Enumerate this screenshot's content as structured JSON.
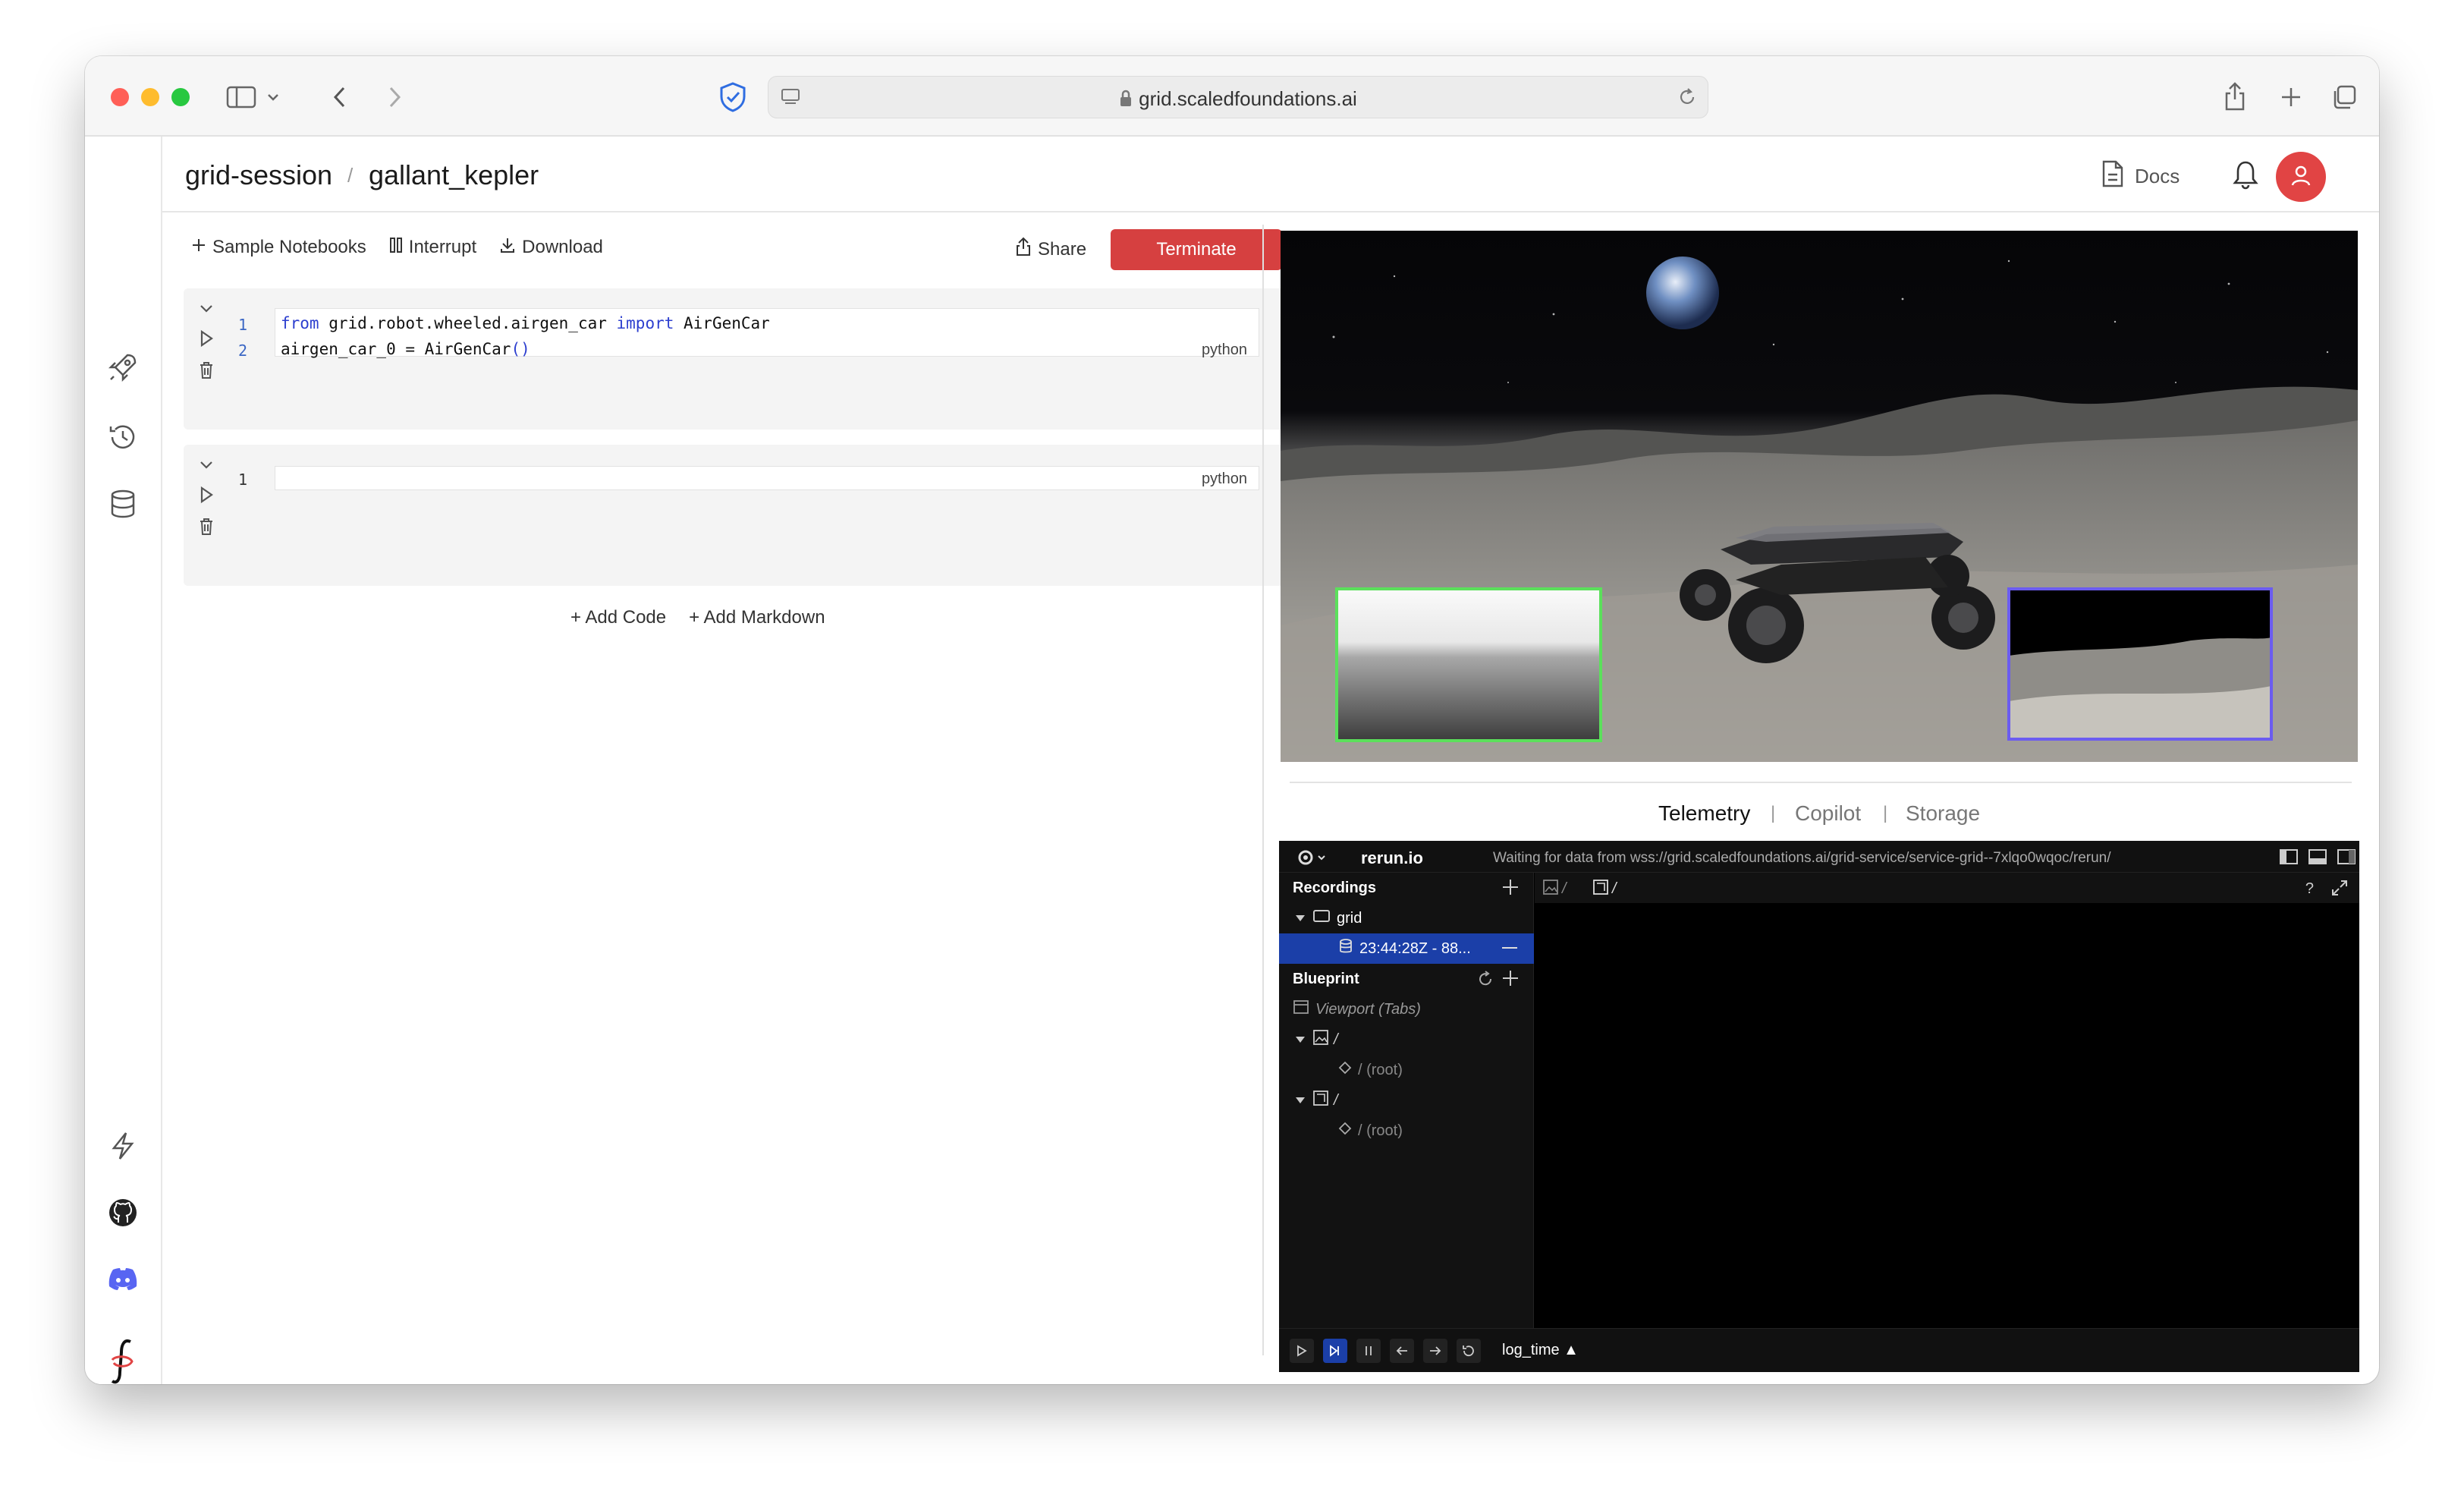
{
  "browser": {
    "url": "grid.scaledfoundations.ai"
  },
  "header": {
    "breadcrumb_root": "grid-session",
    "breadcrumb_sep": "/",
    "breadcrumb_leaf": "gallant_kepler",
    "docs_label": "Docs"
  },
  "notebook": {
    "toolbar": {
      "sample_notebooks": "Sample Notebooks",
      "interrupt": "Interrupt",
      "download": "Download",
      "share": "Share",
      "terminate": "Terminate"
    },
    "cells": [
      {
        "lines": [
          {
            "n": "1",
            "code_a": "from",
            "code_b": " grid.robot.wheeled.airgen_car ",
            "code_c": "import",
            "code_d": " AirGenCar"
          },
          {
            "n": "2",
            "code": "airgen_car_0 = AirGenCar",
            "parens": "()"
          }
        ],
        "language": "python"
      },
      {
        "lines": [
          {
            "n": "1",
            "code": ""
          }
        ],
        "language": "python"
      }
    ],
    "add_code": "+ Add Code",
    "add_markdown": "+ Add Markdown"
  },
  "panel_tabs": {
    "telemetry": "Telemetry",
    "sep1": "|",
    "copilot": "Copilot",
    "sep2": "|",
    "storage": "Storage"
  },
  "rerun": {
    "brand": "rerun.io",
    "status": "Waiting for data from wss://grid.scaledfoundations.ai/grid-service/service-grid--7xlqo0wqoc/rerun/",
    "recordings_label": "Recordings",
    "grid_label": "grid",
    "recording_item": "23:44:28Z - 88...",
    "blueprint_label": "Blueprint",
    "viewport_label": "Viewport (Tabs)",
    "slash1": "/",
    "root1": "/ (root)",
    "slash2": "/",
    "root2": "/ (root)",
    "view_path1": "/",
    "view_path2": "/",
    "help": "?",
    "timeline": "log_time ▲"
  },
  "colors": {
    "terminate": "#d64040",
    "avatar": "#e14444",
    "rerun_selection": "#1b3fa8",
    "depth_frame": "#5be05b",
    "camera_frame": "#6b5cf0"
  }
}
